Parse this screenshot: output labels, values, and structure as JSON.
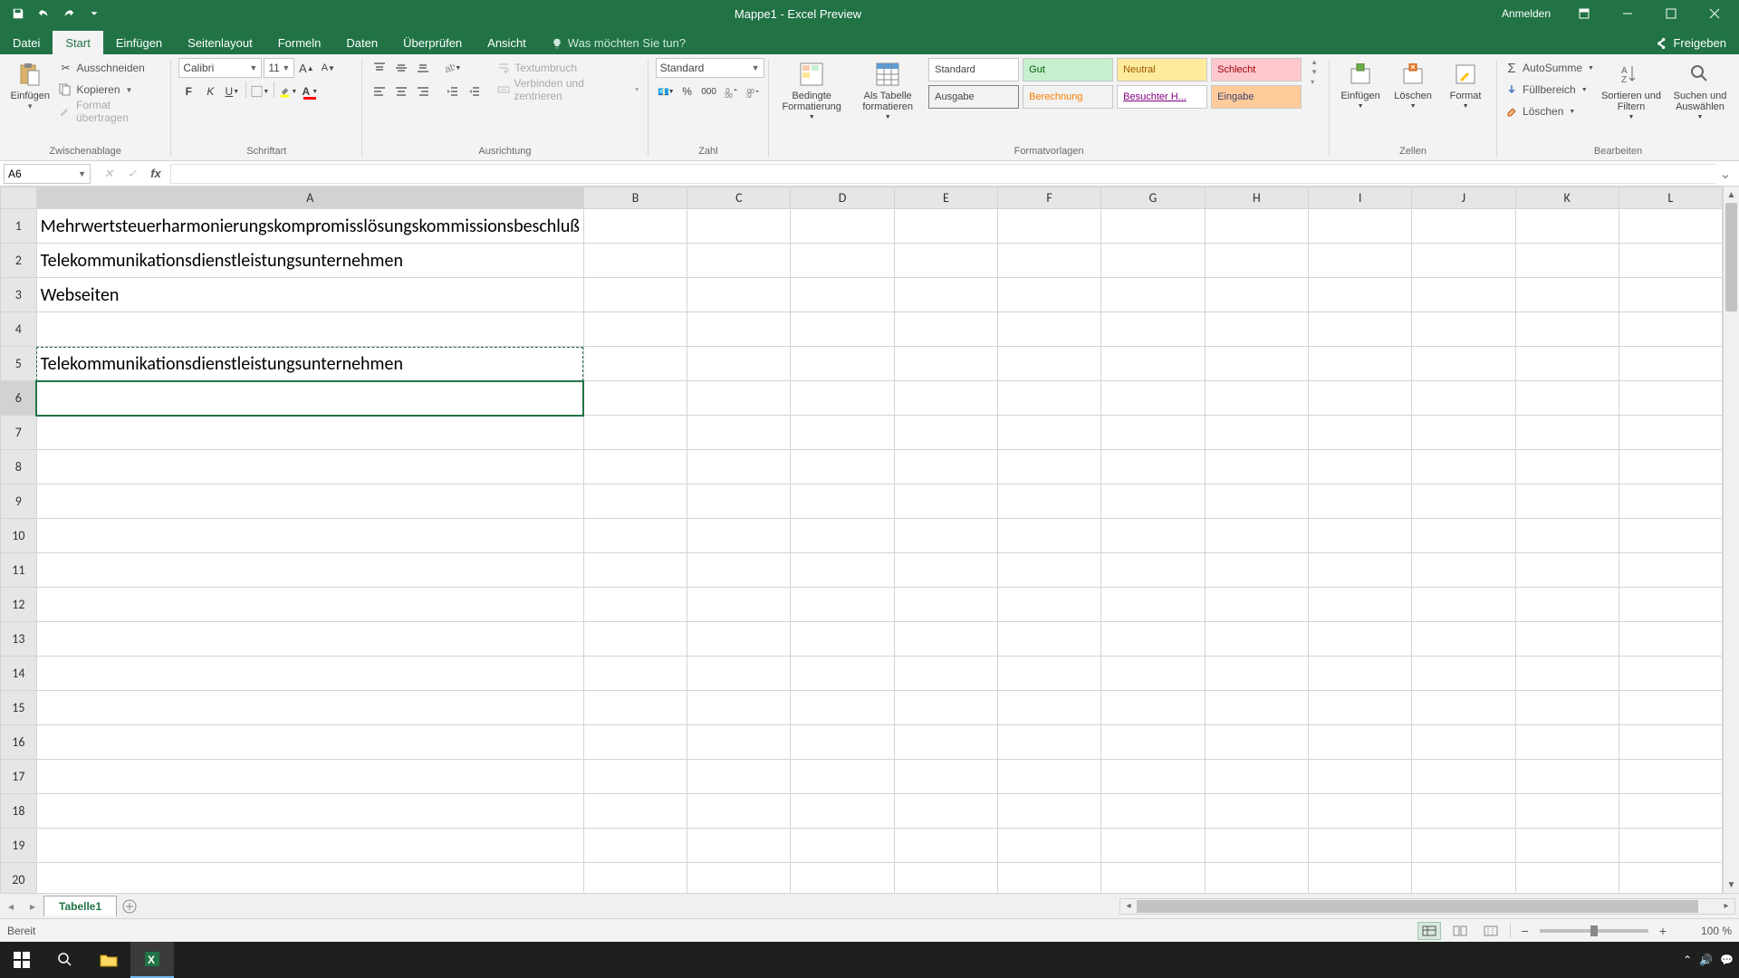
{
  "titlebar": {
    "title": "Mappe1 - Excel Preview",
    "signin": "Anmelden"
  },
  "tabs": {
    "file": "Datei",
    "start": "Start",
    "insert": "Einfügen",
    "layout": "Seitenlayout",
    "formulas": "Formeln",
    "data": "Daten",
    "review": "Überprüfen",
    "view": "Ansicht",
    "tellme": "Was möchten Sie tun?",
    "share": "Freigeben"
  },
  "ribbon": {
    "clipboard": {
      "label": "Zwischenablage",
      "paste": "Einfügen",
      "cut": "Ausschneiden",
      "copy": "Kopieren",
      "painter": "Format übertragen"
    },
    "font": {
      "label": "Schriftart",
      "name": "Calibri",
      "size": "11"
    },
    "align": {
      "label": "Ausrichtung",
      "wrap": "Textumbruch",
      "merge": "Verbinden und zentrieren"
    },
    "number": {
      "label": "Zahl",
      "format": "Standard"
    },
    "styles": {
      "label": "Formatvorlagen",
      "condfmt": "Bedingte Formatierung",
      "astable": "Als Tabelle formatieren",
      "standard": "Standard",
      "gut": "Gut",
      "neutral": "Neutral",
      "schlecht": "Schlecht",
      "ausgabe": "Ausgabe",
      "berechnung": "Berechnung",
      "besuchter": "Besuchter H...",
      "eingabe": "Eingabe"
    },
    "cells": {
      "label": "Zellen",
      "insert": "Einfügen",
      "delete": "Löschen",
      "format": "Format"
    },
    "editing": {
      "label": "Bearbeiten",
      "autosum": "AutoSumme",
      "fill": "Füllbereich",
      "clear": "Löschen",
      "sort": "Sortieren und Filtern",
      "find": "Suchen und Auswählen"
    }
  },
  "namebox": "A6",
  "columns": [
    "A",
    "B",
    "C",
    "D",
    "E",
    "F",
    "G",
    "H",
    "I",
    "J",
    "K",
    "L"
  ],
  "rows": [
    1,
    2,
    3,
    4,
    5,
    6,
    7,
    8,
    9,
    10,
    11,
    12,
    13,
    14,
    15,
    16,
    17,
    18,
    19,
    20
  ],
  "cells": {
    "A1": "Mehrwertsteuerharmonierungskompromisslösungskommissionsbeschluß",
    "A2": "Telekommunikationsdienstleistungsunternehmen",
    "A3": "Webseiten",
    "A5": "Telekommunikationsdienstleistungsunternehmen"
  },
  "marqueeCell": "A5",
  "activeCell": {
    "row": 6,
    "col": "A"
  },
  "sheettab": "Tabelle1",
  "status": {
    "ready": "Bereit",
    "zoom": "100 %"
  }
}
